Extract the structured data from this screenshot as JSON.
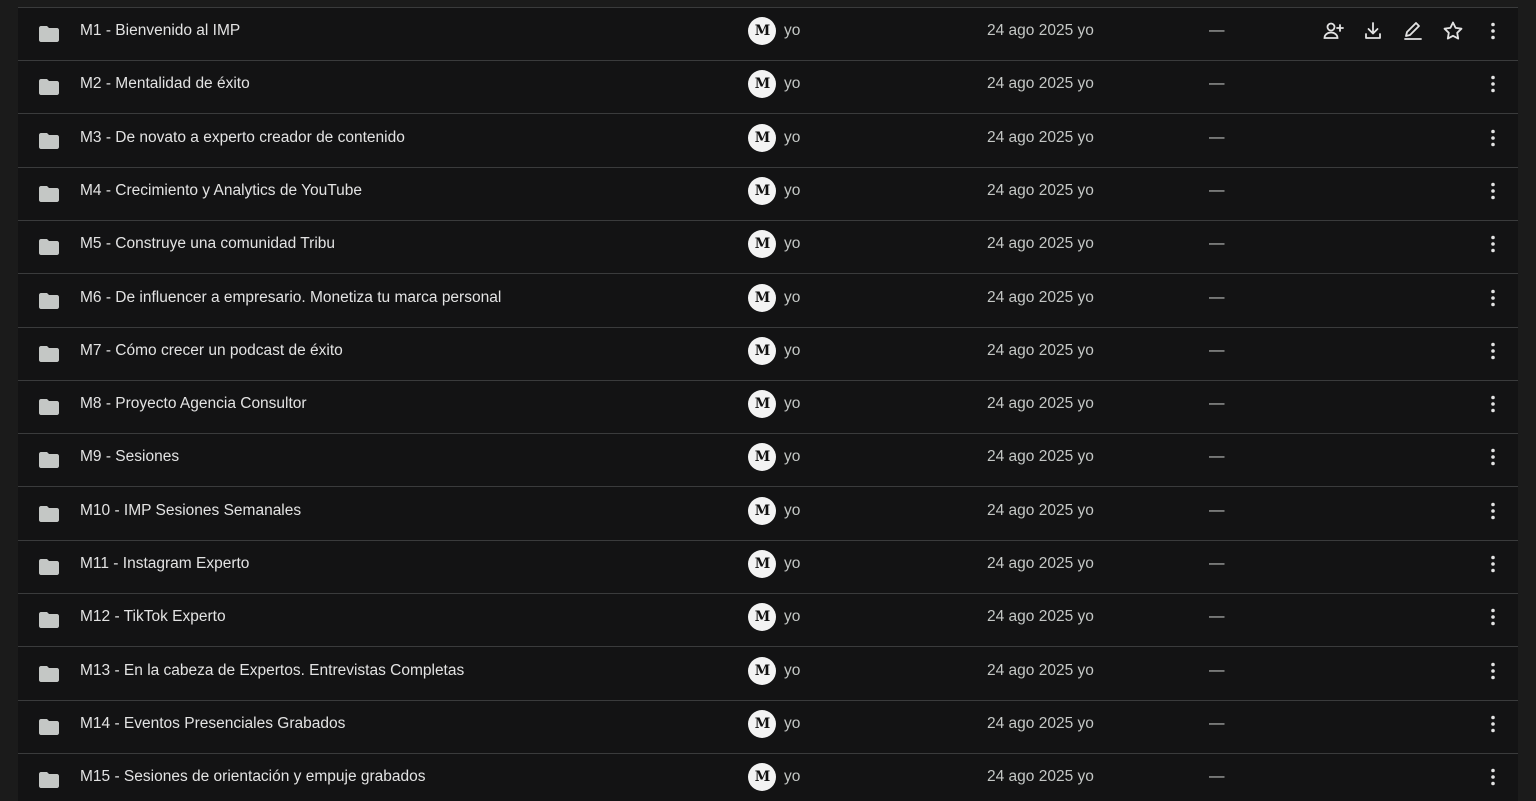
{
  "icons": {
    "folder": "folder-icon",
    "avatar": "owner-avatar",
    "share": "add-person-icon",
    "download": "download-icon",
    "rename": "rename-icon",
    "star": "star-outline-icon",
    "more": "more-vert-icon"
  },
  "colors": {
    "background": "#131314",
    "text": "#e3e3e3",
    "secondary_text": "#c4c7c5",
    "divider": "#3a3b3c"
  },
  "avatar_label": "M",
  "files": [
    {
      "name": "M1 - Bienvenido al IMP",
      "owner": "yo",
      "modified": "24 ago 2025 yo",
      "size": "—"
    },
    {
      "name": "M2 - Mentalidad de éxito",
      "owner": "yo",
      "modified": "24 ago 2025 yo",
      "size": "—"
    },
    {
      "name": "M3 - De novato a experto creador de contenido",
      "owner": "yo",
      "modified": "24 ago 2025 yo",
      "size": "—"
    },
    {
      "name": "M4 - Crecimiento y Analytics de YouTube",
      "owner": "yo",
      "modified": "24 ago 2025 yo",
      "size": "—"
    },
    {
      "name": "M5 - Construye una comunidad Tribu",
      "owner": "yo",
      "modified": "24 ago 2025 yo",
      "size": "—"
    },
    {
      "name": "M6 - De influencer a empresario. Monetiza tu marca personal",
      "owner": "yo",
      "modified": "24 ago 2025 yo",
      "size": "—"
    },
    {
      "name": "M7 - Cómo crecer un podcast de éxito",
      "owner": "yo",
      "modified": "24 ago 2025 yo",
      "size": "—"
    },
    {
      "name": "M8 - Proyecto Agencia Consultor",
      "owner": "yo",
      "modified": "24 ago 2025 yo",
      "size": "—"
    },
    {
      "name": "M9 - Sesiones",
      "owner": "yo",
      "modified": "24 ago 2025 yo",
      "size": "—"
    },
    {
      "name": "M10 - IMP Sesiones Semanales",
      "owner": "yo",
      "modified": "24 ago 2025 yo",
      "size": "—"
    },
    {
      "name": "M11 - Instagram Experto",
      "owner": "yo",
      "modified": "24 ago 2025 yo",
      "size": "—"
    },
    {
      "name": "M12 - TikTok Experto",
      "owner": "yo",
      "modified": "24 ago 2025 yo",
      "size": "—"
    },
    {
      "name": "M13 - En la cabeza de Expertos. Entrevistas Completas",
      "owner": "yo",
      "modified": "24 ago 2025 yo",
      "size": "—"
    },
    {
      "name": "M14 - Eventos Presenciales Grabados",
      "owner": "yo",
      "modified": "24 ago 2025 yo",
      "size": "—"
    },
    {
      "name": "M15 - Sesiones de orientación y empuje grabados",
      "owner": "yo",
      "modified": "24 ago 2025 yo",
      "size": "—"
    }
  ],
  "hovered_row_index": 0
}
